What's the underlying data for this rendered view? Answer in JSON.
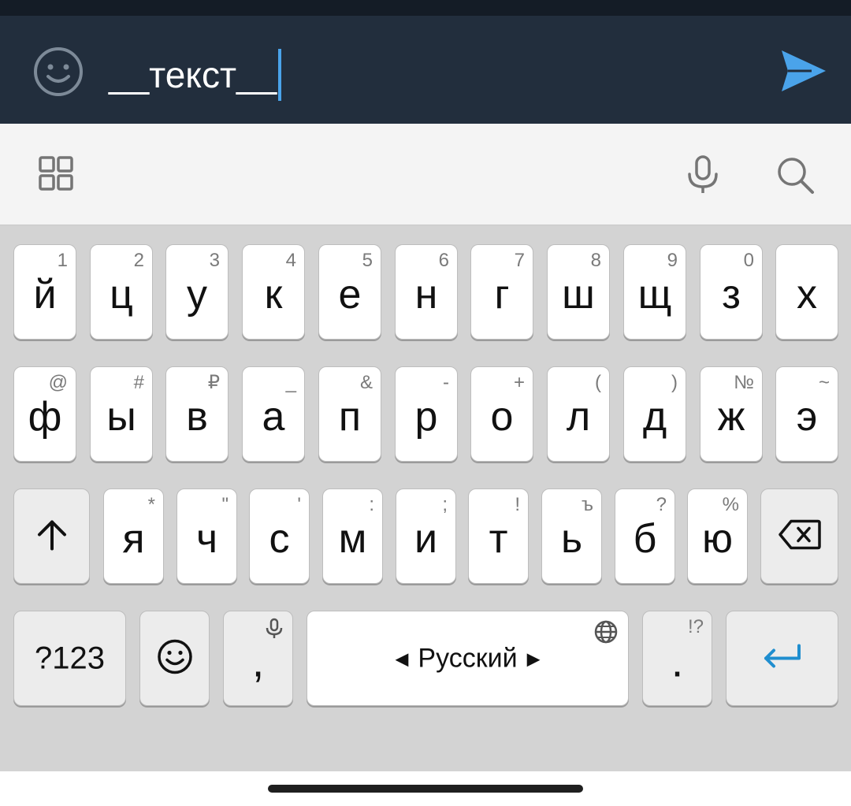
{
  "compose": {
    "emoji_icon": "smiley-face-icon",
    "text_value": "__текст__",
    "send_icon": "send-arrow-icon",
    "send_color": "#4aa3ea"
  },
  "toolbar": {
    "left_icon": "grid-apps-icon",
    "mic_icon": "microphone-icon",
    "search_icon": "search-icon"
  },
  "keyboard": {
    "row1": [
      {
        "char": "й",
        "hint": "1"
      },
      {
        "char": "ц",
        "hint": "2"
      },
      {
        "char": "у",
        "hint": "3"
      },
      {
        "char": "к",
        "hint": "4"
      },
      {
        "char": "е",
        "hint": "5"
      },
      {
        "char": "н",
        "hint": "6"
      },
      {
        "char": "г",
        "hint": "7"
      },
      {
        "char": "ш",
        "hint": "8"
      },
      {
        "char": "щ",
        "hint": "9"
      },
      {
        "char": "з",
        "hint": "0"
      },
      {
        "char": "х",
        "hint": ""
      }
    ],
    "row2": [
      {
        "char": "ф",
        "hint": "@"
      },
      {
        "char": "ы",
        "hint": "#"
      },
      {
        "char": "в",
        "hint": "₽"
      },
      {
        "char": "а",
        "hint": "_"
      },
      {
        "char": "п",
        "hint": "&"
      },
      {
        "char": "р",
        "hint": "-"
      },
      {
        "char": "о",
        "hint": "+"
      },
      {
        "char": "л",
        "hint": "("
      },
      {
        "char": "д",
        "hint": ")"
      },
      {
        "char": "ж",
        "hint": "№"
      },
      {
        "char": "э",
        "hint": "~"
      }
    ],
    "row3": [
      {
        "char": "я",
        "hint": "*"
      },
      {
        "char": "ч",
        "hint": "\""
      },
      {
        "char": "с",
        "hint": "'"
      },
      {
        "char": "м",
        "hint": ":"
      },
      {
        "char": "и",
        "hint": ";"
      },
      {
        "char": "т",
        "hint": "!"
      },
      {
        "char": "ь",
        "hint": "ъ"
      },
      {
        "char": "б",
        "hint": "?"
      },
      {
        "char": "ю",
        "hint": "%"
      }
    ],
    "shift_icon": "shift-arrow-icon",
    "backspace_icon": "backspace-icon",
    "symbols_label": "?123",
    "emoji_key_icon": "smiley-face-icon",
    "comma_label": ",",
    "comma_hint_icon": "microphone-icon",
    "space_label": "Русский",
    "space_hint_icon": "globe-icon",
    "period_label": ".",
    "period_hint": "!?",
    "enter_icon": "enter-return-icon",
    "enter_color": "#1f8ecf"
  }
}
